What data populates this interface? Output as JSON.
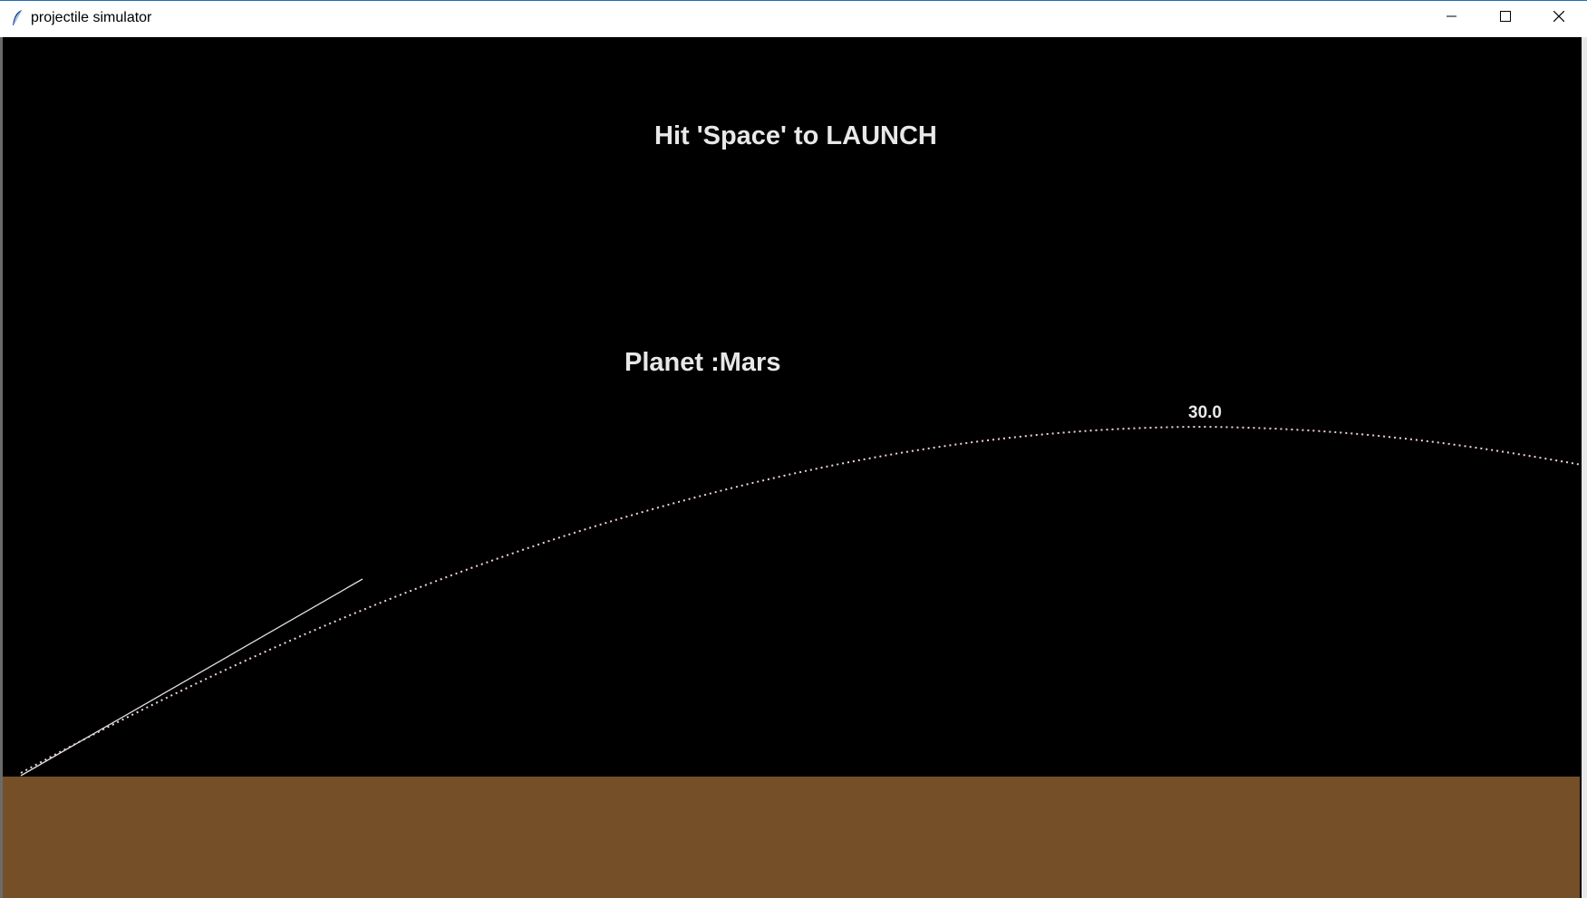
{
  "window": {
    "title": "projectile simulator",
    "icon": "feather-icon",
    "controls": {
      "minimize": "minimize-icon",
      "maximize": "maximize-icon",
      "close": "close-icon"
    }
  },
  "scene": {
    "instruction": "Hit 'Space' to LAUNCH",
    "planet_label": "Planet :Mars",
    "apex_value": "30.0",
    "colors": {
      "sky": "#000000",
      "ground": "#754f28",
      "trajectory": "#f2d4d4",
      "aim_line": "#e0e0e0",
      "text": "#e8e8e8"
    }
  }
}
